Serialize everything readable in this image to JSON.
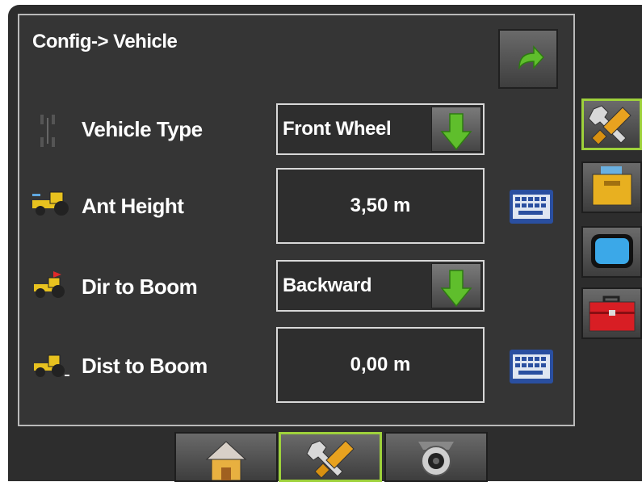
{
  "screen": {
    "breadcrumb": "Config-> Vehicle"
  },
  "rows": [
    {
      "label": "Vehicle Type",
      "value": "Front Wheel",
      "control": "dropdown",
      "icon": "wheelbase-icon"
    },
    {
      "label": "Ant Height",
      "value": "3,50 m",
      "control": "input",
      "icon": "tractor-antenna-icon"
    },
    {
      "label": "Dir to Boom",
      "value": "Backward",
      "control": "dropdown",
      "icon": "tractor-direction-icon"
    },
    {
      "label": "Dist to Boom",
      "value": "0,00 m",
      "control": "input",
      "icon": "tractor-distance-icon"
    }
  ],
  "sidebar": {
    "items": [
      {
        "icon": "tools-icon",
        "active": true
      },
      {
        "icon": "file-drawer-icon",
        "active": false
      },
      {
        "icon": "display-icon",
        "active": false
      },
      {
        "icon": "toolbox-icon",
        "active": false
      }
    ]
  },
  "bottom_nav": {
    "items": [
      {
        "icon": "home-icon",
        "active": false
      },
      {
        "icon": "tools-icon",
        "active": true
      },
      {
        "icon": "camera-icon",
        "active": false
      }
    ]
  },
  "colors": {
    "accent_green": "#9ed13b",
    "arrow_green": "#5fbe2c",
    "panel_bg": "#353535"
  }
}
